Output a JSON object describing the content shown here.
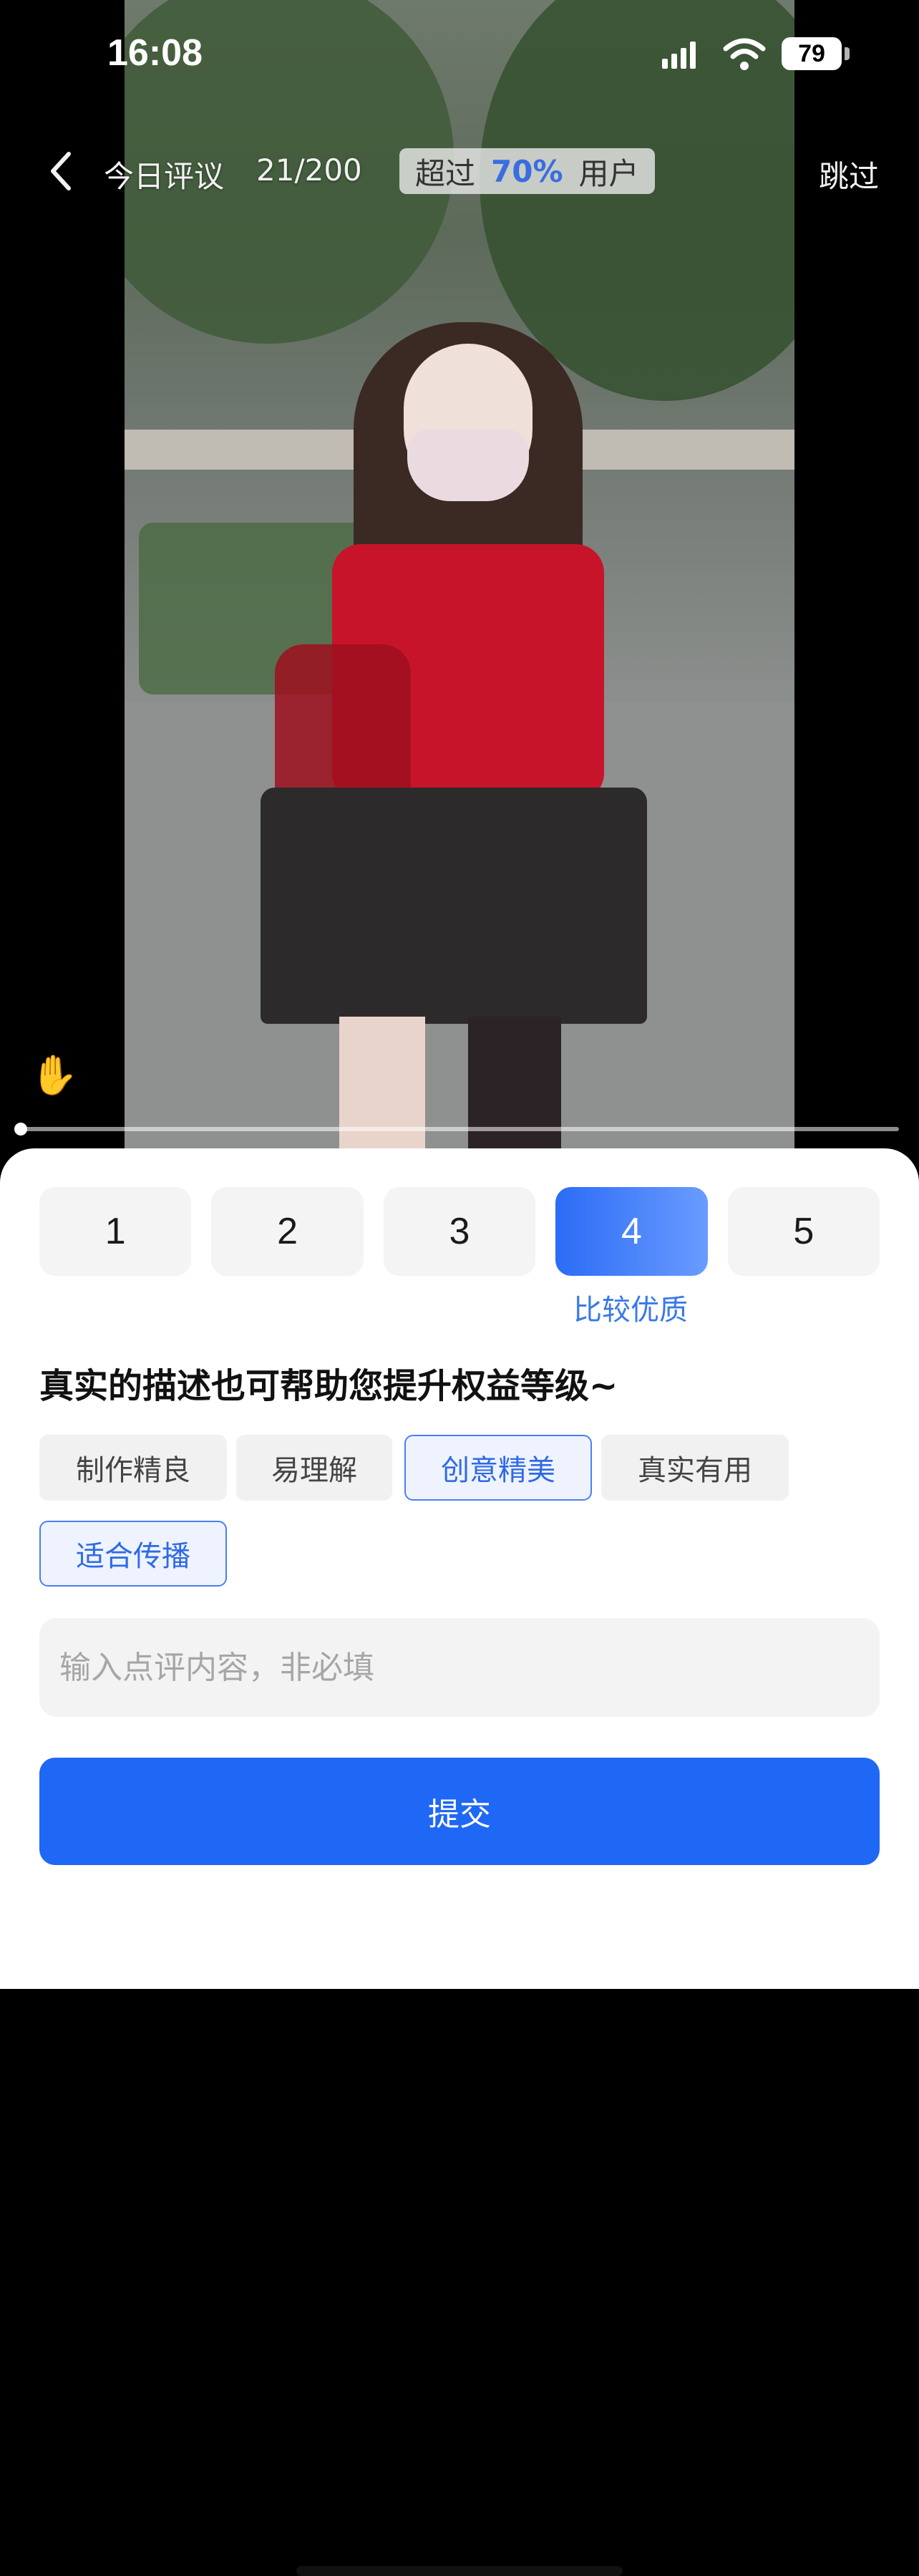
{
  "status_bar": {
    "time": "16:08",
    "battery": "79"
  },
  "nav": {
    "title": "今日评议",
    "count": "21/200",
    "beat_prefix": "超过",
    "beat_percent": "70%",
    "beat_suffix": "用户",
    "skip": "跳过"
  },
  "icons": {
    "back": "chevron-left-icon",
    "hand": "hand-icon",
    "signal": "signal-icon",
    "wifi": "wifi-icon",
    "battery": "battery-icon"
  },
  "video": {
    "progress_fraction": 0.0
  },
  "ratings": {
    "options": [
      "1",
      "2",
      "3",
      "4",
      "5"
    ],
    "selected": "4",
    "selected_desc": "比较优质"
  },
  "prompt": "真实的描述也可帮助您提升权益等级~",
  "tags": [
    {
      "label": "制作精良",
      "selected": false
    },
    {
      "label": "易理解",
      "selected": false
    },
    {
      "label": "创意精美",
      "selected": true
    },
    {
      "label": "真实有用",
      "selected": false
    },
    {
      "label": "适合传播",
      "selected": true
    }
  ],
  "comment": {
    "value": "",
    "placeholder": "输入点评内容，非必填"
  },
  "submit_label": "提交",
  "colors": {
    "accent": "#1f67f5",
    "selected_tag_bg": "#eef3ff",
    "selected_tag_text": "#2f6ae6"
  }
}
